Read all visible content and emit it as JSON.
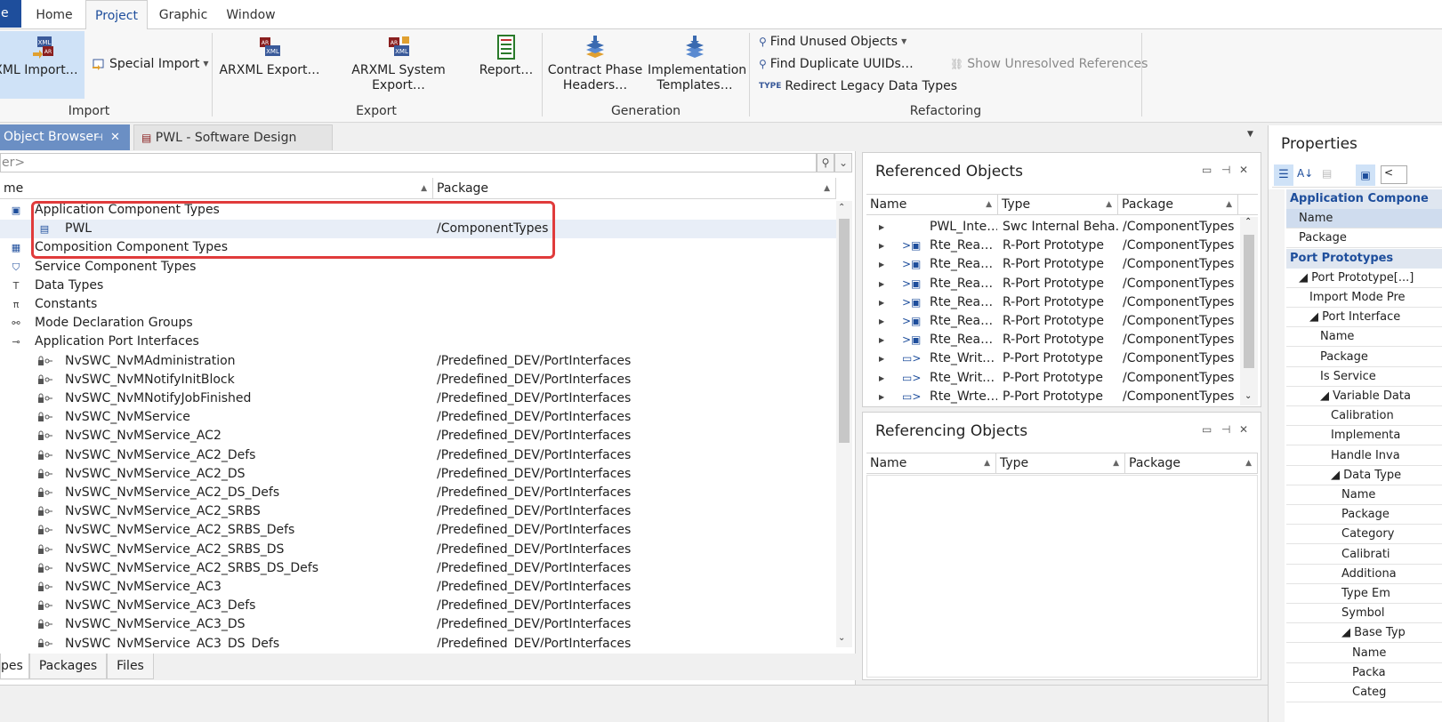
{
  "menu": {
    "file_label": "e",
    "tabs": [
      "Home",
      "Project",
      "Graphic",
      "Window"
    ],
    "active_tab": "Project"
  },
  "ribbon": {
    "groups": {
      "import": "Import",
      "export": "Export",
      "generation": "Generation",
      "refactoring": "Refactoring"
    },
    "buttons": {
      "arxml_import": "XML Import…",
      "special_import": "Special Import",
      "arxml_export": "ARXML Export…",
      "arxml_system_export": "ARXML System Export…",
      "report": "Report…",
      "contract_phase_line1": "Contract Phase",
      "contract_phase_line2": "Headers…",
      "impl_templates_line1": "Implementation",
      "impl_templates_line2": "Templates…",
      "find_unused": "Find Unused Objects",
      "find_duplicate": "Find Duplicate UUIDs…",
      "redirect_legacy": "Redirect Legacy Data Types",
      "show_unresolved": "Show Unresolved References"
    }
  },
  "doc_tabs": {
    "object_browser": "Object Browser",
    "pwl_design": "PWL - Software Design"
  },
  "object_browser": {
    "filter_placeholder": "er>",
    "col_name": "me",
    "col_package": "Package",
    "rows": [
      {
        "name": "Application Component Types",
        "package": "",
        "level": 0,
        "icon": "component-folder-icon"
      },
      {
        "name": "PWL",
        "package": "/ComponentTypes",
        "level": 1,
        "icon": "component-icon",
        "selected": true
      },
      {
        "name": "Composition Component Types",
        "package": "",
        "level": 0,
        "icon": "composition-icon"
      },
      {
        "name": "Service Component Types",
        "package": "",
        "level": 0,
        "icon": "service-icon"
      },
      {
        "name": "Data Types",
        "package": "",
        "level": 0,
        "icon": "datatype-icon"
      },
      {
        "name": "Constants",
        "package": "",
        "level": 0,
        "icon": "pi-icon"
      },
      {
        "name": "Mode Declaration Groups",
        "package": "",
        "level": 0,
        "icon": "mode-icon"
      },
      {
        "name": "Application Port Interfaces",
        "package": "",
        "level": 0,
        "icon": "port-interface-icon"
      },
      {
        "name": "NvSWC_NvMAdministration",
        "package": "/Predefined_DEV/PortInterfaces",
        "level": 1,
        "icon": "locked-interface-icon"
      },
      {
        "name": "NvSWC_NvMNotifyInitBlock",
        "package": "/Predefined_DEV/PortInterfaces",
        "level": 1,
        "icon": "locked-interface-icon"
      },
      {
        "name": "NvSWC_NvMNotifyJobFinished",
        "package": "/Predefined_DEV/PortInterfaces",
        "level": 1,
        "icon": "locked-interface-icon"
      },
      {
        "name": "NvSWC_NvMService",
        "package": "/Predefined_DEV/PortInterfaces",
        "level": 1,
        "icon": "locked-interface-icon"
      },
      {
        "name": "NvSWC_NvMService_AC2",
        "package": "/Predefined_DEV/PortInterfaces",
        "level": 1,
        "icon": "locked-interface-icon"
      },
      {
        "name": "NvSWC_NvMService_AC2_Defs",
        "package": "/Predefined_DEV/PortInterfaces",
        "level": 1,
        "icon": "locked-interface-icon"
      },
      {
        "name": "NvSWC_NvMService_AC2_DS",
        "package": "/Predefined_DEV/PortInterfaces",
        "level": 1,
        "icon": "locked-interface-icon"
      },
      {
        "name": "NvSWC_NvMService_AC2_DS_Defs",
        "package": "/Predefined_DEV/PortInterfaces",
        "level": 1,
        "icon": "locked-interface-icon"
      },
      {
        "name": "NvSWC_NvMService_AC2_SRBS",
        "package": "/Predefined_DEV/PortInterfaces",
        "level": 1,
        "icon": "locked-interface-icon"
      },
      {
        "name": "NvSWC_NvMService_AC2_SRBS_Defs",
        "package": "/Predefined_DEV/PortInterfaces",
        "level": 1,
        "icon": "locked-interface-icon"
      },
      {
        "name": "NvSWC_NvMService_AC2_SRBS_DS",
        "package": "/Predefined_DEV/PortInterfaces",
        "level": 1,
        "icon": "locked-interface-icon"
      },
      {
        "name": "NvSWC_NvMService_AC2_SRBS_DS_Defs",
        "package": "/Predefined_DEV/PortInterfaces",
        "level": 1,
        "icon": "locked-interface-icon"
      },
      {
        "name": "NvSWC_NvMService_AC3",
        "package": "/Predefined_DEV/PortInterfaces",
        "level": 1,
        "icon": "locked-interface-icon"
      },
      {
        "name": "NvSWC_NvMService_AC3_Defs",
        "package": "/Predefined_DEV/PortInterfaces",
        "level": 1,
        "icon": "locked-interface-icon"
      },
      {
        "name": "NvSWC_NvMService_AC3_DS",
        "package": "/Predefined_DEV/PortInterfaces",
        "level": 1,
        "icon": "locked-interface-icon"
      },
      {
        "name": "NvSWC_NvMService_AC3_DS_Defs",
        "package": "/Predefined_DEV/PortInterfaces",
        "level": 1,
        "icon": "locked-interface-icon"
      }
    ],
    "bottom_tabs": [
      "pes",
      "Packages",
      "Files"
    ]
  },
  "referenced": {
    "title": "Referenced Objects",
    "cols": [
      "Name",
      "Type",
      "Package"
    ],
    "rows": [
      {
        "name": "PWL_Inte…",
        "type": "Swc Internal Beha…",
        "package": "/ComponentTypes",
        "icon": ""
      },
      {
        "name": "Rte_Rea…",
        "type": "R-Port Prototype",
        "package": "/ComponentTypes",
        "icon": "rport-icon"
      },
      {
        "name": "Rte_Rea…",
        "type": "R-Port Prototype",
        "package": "/ComponentTypes",
        "icon": "rport-icon"
      },
      {
        "name": "Rte_Rea…",
        "type": "R-Port Prototype",
        "package": "/ComponentTypes",
        "icon": "rport-icon"
      },
      {
        "name": "Rte_Rea…",
        "type": "R-Port Prototype",
        "package": "/ComponentTypes",
        "icon": "rport-icon"
      },
      {
        "name": "Rte_Rea…",
        "type": "R-Port Prototype",
        "package": "/ComponentTypes",
        "icon": "rport-icon"
      },
      {
        "name": "Rte_Rea…",
        "type": "R-Port Prototype",
        "package": "/ComponentTypes",
        "icon": "rport-icon"
      },
      {
        "name": "Rte_Writ…",
        "type": "P-Port Prototype",
        "package": "/ComponentTypes",
        "icon": "pport-icon"
      },
      {
        "name": "Rte_Writ…",
        "type": "P-Port Prototype",
        "package": "/ComponentTypes",
        "icon": "pport-icon"
      },
      {
        "name": "Rte_Wrte…",
        "type": "P-Port Prototype",
        "package": "/ComponentTypes",
        "icon": "pport-icon"
      }
    ]
  },
  "referencing": {
    "title": "Referencing Objects",
    "cols": [
      "Name",
      "Type",
      "Package"
    ]
  },
  "properties": {
    "title": "Properties",
    "rows": [
      {
        "kind": "cat",
        "label": "Application Compone"
      },
      {
        "kind": "row",
        "label": "Name",
        "indent": 0,
        "selected": true
      },
      {
        "kind": "row",
        "label": "Package",
        "indent": 0
      },
      {
        "kind": "cat",
        "label": "Port Prototypes"
      },
      {
        "kind": "row",
        "label": "◢ Port Prototype[...]",
        "indent": 0
      },
      {
        "kind": "row",
        "label": "Import Mode Pre",
        "indent": 1
      },
      {
        "kind": "row",
        "label": "◢ Port Interface",
        "indent": 1
      },
      {
        "kind": "row",
        "label": "Name",
        "indent": 2
      },
      {
        "kind": "row",
        "label": "Package",
        "indent": 2
      },
      {
        "kind": "row",
        "label": "Is Service",
        "indent": 2
      },
      {
        "kind": "row",
        "label": "◢ Variable Data",
        "indent": 2
      },
      {
        "kind": "row",
        "label": "Calibration",
        "indent": 3
      },
      {
        "kind": "row",
        "label": "Implementa",
        "indent": 3
      },
      {
        "kind": "row",
        "label": "Handle Inva",
        "indent": 3
      },
      {
        "kind": "row",
        "label": "◢ Data Type",
        "indent": 3
      },
      {
        "kind": "row",
        "label": "Name",
        "indent": 4
      },
      {
        "kind": "row",
        "label": "Package",
        "indent": 4
      },
      {
        "kind": "row",
        "label": "Category",
        "indent": 4
      },
      {
        "kind": "row",
        "label": "Calibrati",
        "indent": 4
      },
      {
        "kind": "row",
        "label": "Additiona",
        "indent": 4
      },
      {
        "kind": "row",
        "label": "Type Em",
        "indent": 4
      },
      {
        "kind": "row",
        "label": "Symbol",
        "indent": 4
      },
      {
        "kind": "row",
        "label": "◢ Base Typ",
        "indent": 4
      },
      {
        "kind": "row",
        "label": "Name",
        "indent": 5
      },
      {
        "kind": "row",
        "label": "Packa",
        "indent": 5
      },
      {
        "kind": "row",
        "label": "Categ",
        "indent": 5
      }
    ]
  }
}
